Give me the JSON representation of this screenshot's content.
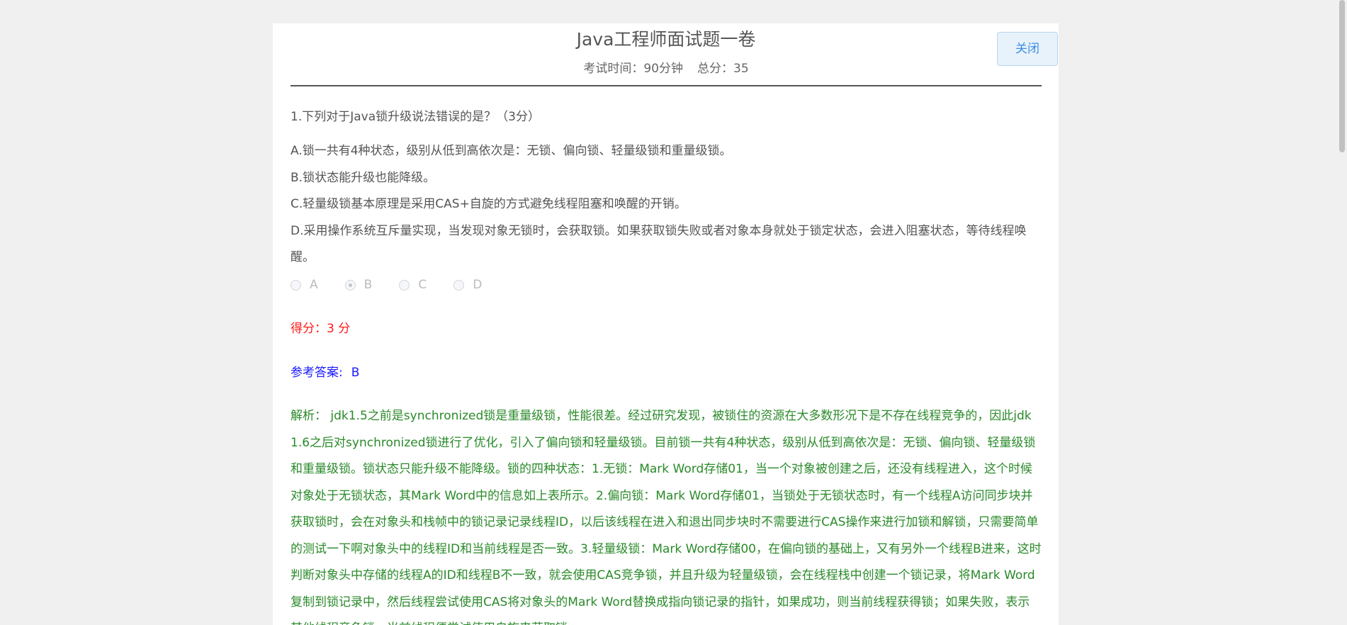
{
  "exam": {
    "title": "Java工程师面试题一卷",
    "time_label": "考试时间：90分钟",
    "total_label": "总分：35",
    "close_label": "关闭"
  },
  "question": {
    "text": "1.下列对于Java锁升级说法错误的是？（3分）",
    "options": [
      "A.锁一共有4种状态，级别从低到高依次是：无锁、偏向锁、轻量级锁和重量级锁。",
      "B.锁状态能升级也能降级。",
      "C.轻量级锁基本原理是采用CAS+自旋的方式避免线程阻塞和唤醒的开销。",
      "D.采用操作系统互斥量实现，当发现对象无锁时，会获取锁。如果获取锁失败或者对象本身就处于锁定状态，会进入阻塞状态，等待线程唤醒。"
    ],
    "choices": [
      {
        "label": "A",
        "checked": false
      },
      {
        "label": "B",
        "checked": true
      },
      {
        "label": "C",
        "checked": false
      },
      {
        "label": "D",
        "checked": false
      }
    ]
  },
  "result": {
    "score_label": "得分：3 分",
    "answer_label": "参考答案:",
    "answer_value": "B",
    "analysis": "解析： jdk1.5之前是synchronized锁是重量级锁，性能很差。经过研究发现，被锁住的资源在大多数形况下是不存在线程竞争的，因此jdk1.6之后对synchronized锁进行了优化，引入了偏向锁和轻量级锁。目前锁一共有4种状态，级别从低到高依次是：无锁、偏向锁、轻量级锁和重量级锁。锁状态只能升级不能降级。锁的四种状态：1.无锁：Mark Word存储01，当一个对象被创建之后，还没有线程进入，这个时候对象处于无锁状态，其Mark Word中的信息如上表所示。2.偏向锁：Mark Word存储01，当锁处于无锁状态时，有一个线程A访问同步块并获取锁时，会在对象头和栈帧中的锁记录记录线程ID，以后该线程在进入和退出同步块时不需要进行CAS操作来进行加锁和解锁，只需要简单的测试一下啊对象头中的线程ID和当前线程是否一致。3.轻量级锁：Mark Word存储00，在偏向锁的基础上，又有另外一个线程B进来，这时判断对象头中存储的线程A的ID和线程B不一致，就会使用CAS竞争锁，并且升级为轻量级锁，会在线程栈中创建一个锁记录，将Mark Word复制到锁记录中，然后线程尝试使用CAS将对象头的Mark Word替换成指向锁记录的指针，如果成功，则当前线程获得锁；如果失败，表示其他线程竞争锁，当前线程便尝试使用自旋来获取锁。"
  },
  "colors": {
    "score": "#ff1a1a",
    "answer": "#1a1aff",
    "analysis": "#2a8a2a",
    "close_button": "#3a8ee6"
  }
}
